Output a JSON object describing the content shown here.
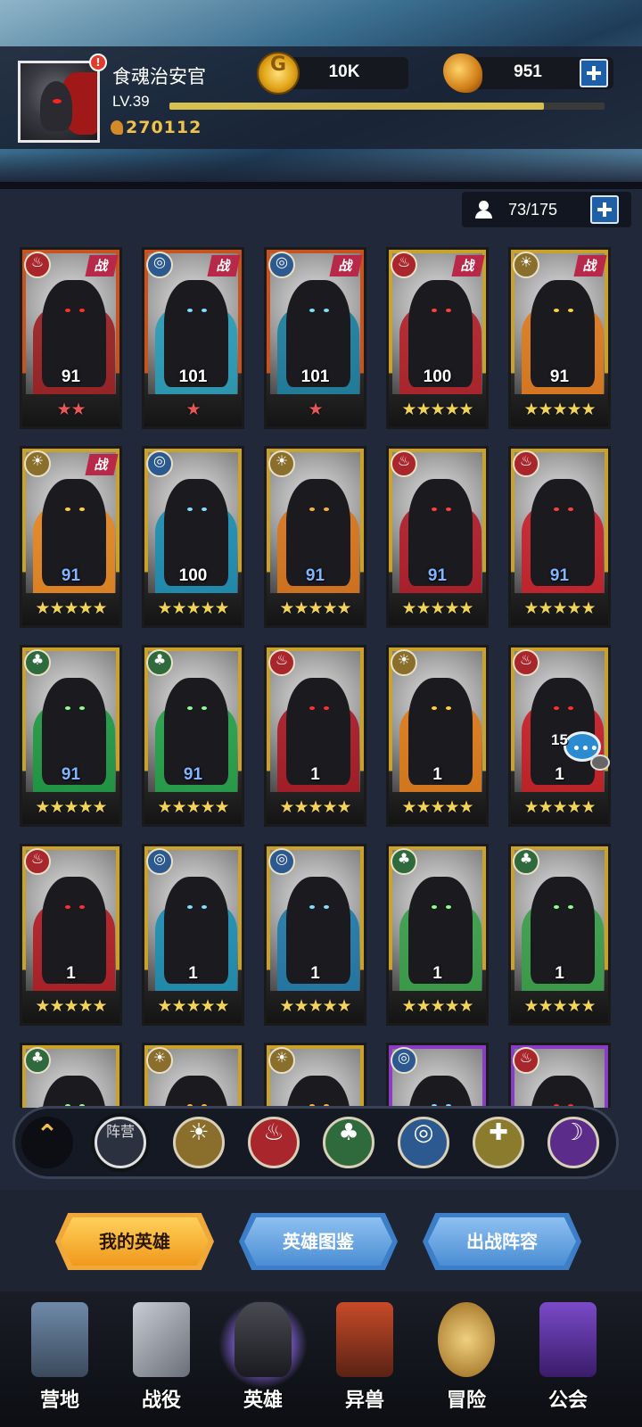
{
  "player": {
    "name": "食魂治安官",
    "level": "LV.39",
    "power": "270112",
    "alert": "!",
    "xp_fraction": 0.86
  },
  "resources": {
    "gold": "10K",
    "gems": "951"
  },
  "roster": {
    "count": "73/175"
  },
  "heroes": [
    {
      "level": "91",
      "stars": "★★",
      "star_color": "red",
      "faction": "fire",
      "battle": true,
      "cloak": "#9c1f22",
      "eye": "#ff3030",
      "frame": "#c8531f"
    },
    {
      "level": "101",
      "stars": "★",
      "star_color": "red",
      "faction": "water",
      "battle": true,
      "cloak": "#2a9cb8",
      "eye": "#7fe0ff",
      "frame": "#c8531f"
    },
    {
      "level": "101",
      "stars": "★",
      "star_color": "red",
      "faction": "water",
      "battle": true,
      "cloak": "#1c7fa0",
      "eye": "#7fe0ff",
      "frame": "#c8531f"
    },
    {
      "level": "100",
      "stars": "★★★★★",
      "star_color": "gold",
      "faction": "fire",
      "battle": true,
      "cloak": "#b3202a",
      "eye": "#ff4040",
      "frame": "#c9a227"
    },
    {
      "level": "91",
      "stars": "★★★★★",
      "star_color": "gold",
      "faction": "sun",
      "battle": true,
      "cloak": "#e07a1c",
      "eye": "#ffd040",
      "frame": "#c9a227"
    },
    {
      "level": "91",
      "stars": "★★★★★",
      "star_color": "gold",
      "faction": "sun",
      "battle": true,
      "cloak": "#e8861e",
      "eye": "#ffd040",
      "frame": "#c9a227"
    },
    {
      "level": "100",
      "stars": "★★★★★",
      "star_color": "gold",
      "faction": "water",
      "battle": false,
      "cloak": "#1d8eb4",
      "eye": "#7fe0ff",
      "frame": "#c9a227"
    },
    {
      "level": "91",
      "stars": "★★★★★",
      "star_color": "gold",
      "faction": "sun",
      "battle": false,
      "cloak": "#d8741a",
      "eye": "#ffb040",
      "frame": "#c9a227"
    },
    {
      "level": "91",
      "stars": "★★★★★",
      "star_color": "gold",
      "faction": "fire",
      "battle": false,
      "cloak": "#b01c28",
      "eye": "#ff4040",
      "frame": "#c9a227"
    },
    {
      "level": "91",
      "stars": "★★★★★",
      "star_color": "gold",
      "faction": "fire",
      "battle": false,
      "cloak": "#c8202a",
      "eye": "#ff4040",
      "frame": "#c9a227"
    },
    {
      "level": "91",
      "stars": "★★★★★",
      "star_color": "gold",
      "faction": "wood",
      "battle": false,
      "cloak": "#1d9a40",
      "eye": "#90ff90",
      "frame": "#c9a227"
    },
    {
      "level": "91",
      "stars": "★★★★★",
      "star_color": "gold",
      "faction": "wood",
      "battle": false,
      "cloak": "#23a048",
      "eye": "#90ff90",
      "frame": "#c9a227"
    },
    {
      "level": "1",
      "stars": "★★★★★",
      "star_color": "gold",
      "faction": "fire",
      "battle": false,
      "cloak": "#a81824",
      "eye": "#ff3030",
      "frame": "#c9a227"
    },
    {
      "level": "1",
      "stars": "★★★★★",
      "star_color": "gold",
      "faction": "sun",
      "battle": false,
      "cloak": "#e07a18",
      "eye": "#ffd040",
      "frame": "#c9a227"
    },
    {
      "level": "1",
      "stars": "★★★★★",
      "star_color": "gold",
      "faction": "fire",
      "battle": false,
      "cloak": "#c81e24",
      "eye": "#ff3030",
      "frame": "#c9a227"
    },
    {
      "level": "1",
      "stars": "★★★★★",
      "star_color": "gold",
      "faction": "fire",
      "battle": false,
      "cloak": "#b01c22",
      "eye": "#ff3030",
      "frame": "#c9a227"
    },
    {
      "level": "1",
      "stars": "★★★★★",
      "star_color": "gold",
      "faction": "water",
      "battle": false,
      "cloak": "#1d8eb4",
      "eye": "#7fe0ff",
      "frame": "#c9a227"
    },
    {
      "level": "1",
      "stars": "★★★★★",
      "star_color": "gold",
      "faction": "water",
      "battle": false,
      "cloak": "#1f7aa8",
      "eye": "#7fe0ff",
      "frame": "#c9a227"
    },
    {
      "level": "1",
      "stars": "★★★★★",
      "star_color": "gold",
      "faction": "wood",
      "battle": false,
      "cloak": "#3aa048",
      "eye": "#90ff90",
      "frame": "#c9a227"
    },
    {
      "level": "1",
      "stars": "★★★★★",
      "star_color": "gold",
      "faction": "wood",
      "battle": false,
      "cloak": "#3aa048",
      "eye": "#90ff90",
      "frame": "#c9a227"
    },
    {
      "level": "",
      "stars": "",
      "star_color": "gold",
      "faction": "wood",
      "battle": false,
      "cloak": "#1d9a40",
      "eye": "#90ff90",
      "frame": "#c9a227"
    },
    {
      "level": "",
      "stars": "",
      "star_color": "gold",
      "faction": "sun",
      "battle": false,
      "cloak": "#d8741a",
      "eye": "#ffb040",
      "frame": "#c9a227"
    },
    {
      "level": "",
      "stars": "",
      "star_color": "gold",
      "faction": "sun",
      "battle": false,
      "cloak": "#d8741a",
      "eye": "#ffb040",
      "frame": "#c9a227"
    },
    {
      "level": "",
      "stars": "",
      "star_color": "gold",
      "faction": "water",
      "battle": false,
      "cloak": "#1d8eb4",
      "eye": "#7fe0ff",
      "frame": "#8a3cc8"
    },
    {
      "level": "",
      "stars": "",
      "star_color": "gold",
      "faction": "fire",
      "battle": false,
      "cloak": "#b01c22",
      "eye": "#ff3030",
      "frame": "#8a3cc8"
    }
  ],
  "battle_tag": "战",
  "chat": {
    "count": "15",
    "dots": "•••"
  },
  "filters": {
    "camp_label": "阵营"
  },
  "tabs": [
    "我的英雄",
    "英雄图鉴",
    "出战阵容"
  ],
  "nav": [
    "营地",
    "战役",
    "英雄",
    "异兽",
    "冒险",
    "公会"
  ],
  "colors": {
    "gold_text": "#f1c24a",
    "tab_active": "#f0a83a",
    "tab_inactive": "#3c7ec8"
  }
}
